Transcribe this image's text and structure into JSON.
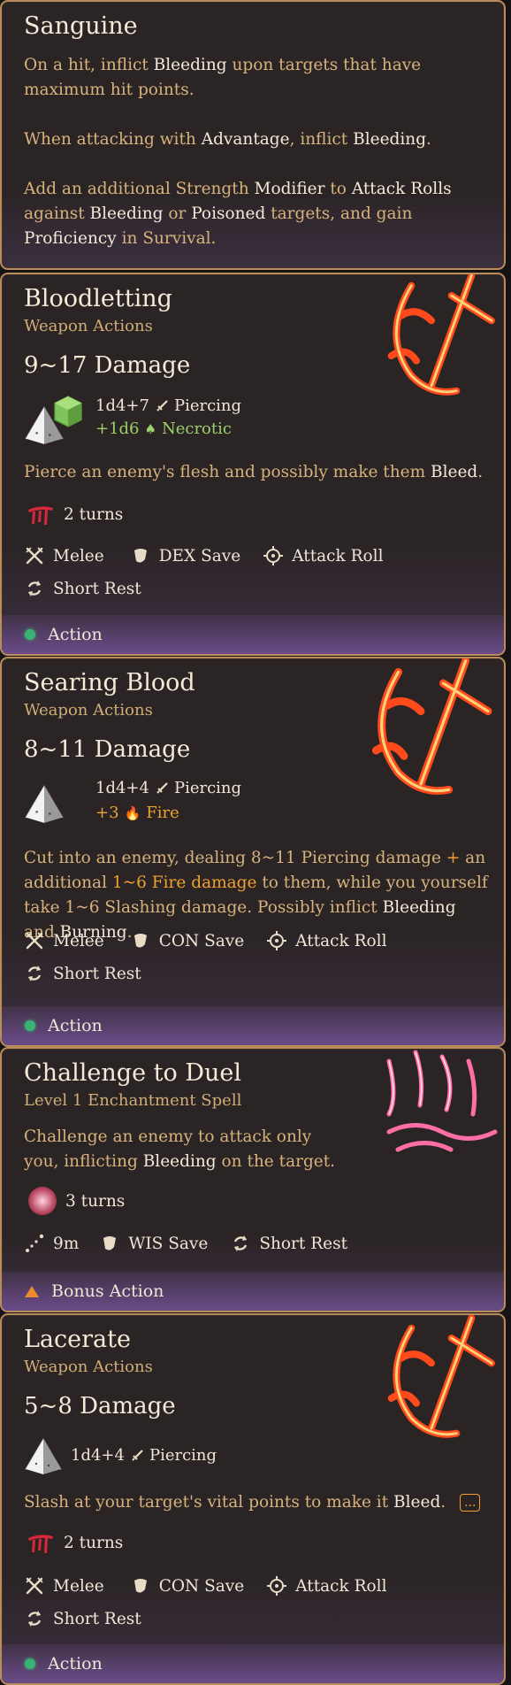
{
  "cards": [
    {
      "title": "Sanguine",
      "paragraphs": [
        [
          "On a hit, inflict ",
          "Bleeding",
          " upon targets that have maximum hit points."
        ],
        [
          "When attacking with ",
          "Advantage",
          ", inflict ",
          "Bleeding",
          "."
        ],
        [
          "Add an additional Strength ",
          "Modifier",
          " to ",
          "Attack Rolls",
          " against ",
          "Bleeding",
          " or ",
          "Poisoned",
          " targets, and gain ",
          "Proficiency",
          " in Survival."
        ]
      ]
    },
    {
      "title": "Bloodletting",
      "subtitle": "Weapon Actions",
      "damage": "9~17 Damage",
      "dmg1": "1d4+7",
      "dmg1_type": "Piercing",
      "dmg2": "+1d6",
      "dmg2_type": "Necrotic",
      "desc_a": "Pierce an enemy's flesh and possibly make them ",
      "desc_b": "Bleed",
      "desc_c": ".",
      "duration": "2 turns",
      "range": "Melee",
      "save": "DEX Save",
      "roll": "Attack Roll",
      "recharge": "Short Rest",
      "cost": "Action"
    },
    {
      "title": "Searing Blood",
      "subtitle": "Weapon Actions",
      "damage": "8~11 Damage",
      "dmg1": "1d4+4",
      "dmg1_type": "Piercing",
      "dmg2": "+3",
      "dmg2_type": "Fire",
      "desc_a": "Cut into an enemy, dealing 8~11 Piercing damage ",
      "desc_plus": "+",
      "desc_b": " an additional ",
      "desc_fire": "1~6 Fire damage",
      "desc_c": " to them, while you yourself take 1~6 Slashing damage. Possibly inflict ",
      "desc_bleed": "Bleeding",
      "desc_and": " and ",
      "desc_burn": "Burning",
      "desc_end": ".",
      "range": "Melee",
      "save": "CON Save",
      "roll": "Attack Roll",
      "recharge": "Short Rest",
      "cost": "Action"
    },
    {
      "title": "Challenge to Duel",
      "subtitle": "Level 1 Enchantment Spell",
      "desc_a": "Challenge an enemy to attack only you, inflicting ",
      "desc_b": "Bleeding",
      "desc_c": " on the target.",
      "duration": "3 turns",
      "range": "9m",
      "save": "WIS Save",
      "recharge": "Short Rest",
      "cost": "Bonus Action"
    },
    {
      "title": "Lacerate",
      "subtitle": "Weapon Actions",
      "damage": "5~8 Damage",
      "dmg1": "1d4+4",
      "dmg1_type": "Piercing",
      "desc_a": "Slash at your target's vital points to make it ",
      "desc_b": "Bleed",
      "desc_c": ".",
      "more": "...",
      "duration": "2 turns",
      "range": "Melee",
      "save": "CON Save",
      "roll": "Attack Roll",
      "recharge": "Short Rest",
      "cost": "Action"
    }
  ],
  "colors": {
    "border": "#b98c5b",
    "highlight": "#f4ead8",
    "body_text": "#d8b27c",
    "fire": "#f0a030",
    "necrotic": "#9bd06a",
    "action_dot": "#3bb273",
    "bonus_action": "#e98a2c"
  }
}
